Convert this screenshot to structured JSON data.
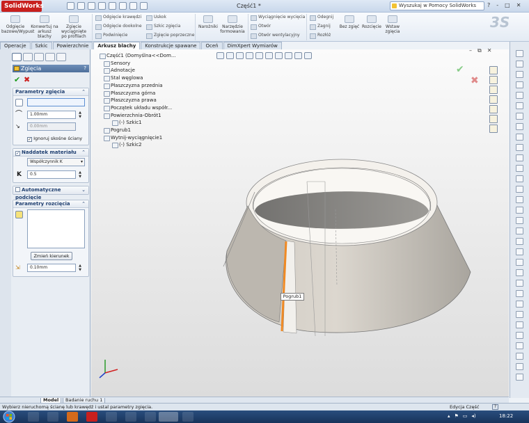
{
  "app": {
    "name": "SolidWorks",
    "doc_title": "Część1 *",
    "help_search": "Wyszukaj w Pomocy SolidWorks",
    "title_controls": [
      "?",
      "-",
      "□",
      "✕"
    ]
  },
  "ribbon": {
    "big_buttons": [
      {
        "label": "Odgięcie bazowe/Wypust"
      },
      {
        "label": "Konwertuj na arkusz blachy"
      },
      {
        "label": "Zgięcie wyciągnięte po profilach"
      }
    ],
    "col2": [
      "Odgięcie krawędzi",
      "Odgięcie dookolne",
      "Podwinięcie"
    ],
    "col3": [
      "Uskok",
      "Szkic zgięcia",
      "Zgięcie poprzeczne"
    ],
    "narozniki": "Narożniki",
    "narzedzie": "Narzędzie formowania",
    "col6": [
      "Wyciągnięcie wycięcia",
      "Otwór",
      "Otwór wentylacyjny"
    ],
    "col7": [
      "Odegnij",
      "Zagnij",
      "Rozłóż"
    ],
    "bez_zgiec": "Bez zgięć",
    "rozciecie": "Rozcięcie",
    "wstaw_zgiecia": "Wstaw zgięcia"
  },
  "tabs": [
    "Operacje",
    "Szkic",
    "Powierzchnie",
    "Arkusz blachy",
    "Konstrukcje spawane",
    "Oceń",
    "DimXpert Wymiarów"
  ],
  "active_tab": "Arkusz blachy",
  "property_manager": {
    "title": "Zgięcia",
    "help": "?",
    "ok": "✔",
    "cancel": "✖",
    "bend_params": {
      "header": "Parametry zgięcia",
      "radius": "1.00mm",
      "thickness": "0.00mm",
      "ignore_label": "Ignoruj skośne ściany",
      "ignore_checked": true
    },
    "allowance": {
      "header": "Naddatek materiału",
      "type": "Współczynnik K",
      "k_label": "K",
      "k_value": "0.5"
    },
    "auto_relief": {
      "header": "Automatyczne podcięcie"
    },
    "rip": {
      "header": "Parametry rozcięcia",
      "button": "Zmień kierunek",
      "gap": "0.10mm"
    }
  },
  "feature_tree": [
    {
      "label": "Część1  (Domyślna<<Dom..."
    },
    {
      "label": "Sensory"
    },
    {
      "label": "Adnotacje"
    },
    {
      "label": "Stal węglowa"
    },
    {
      "label": "Płaszczyzna przednia"
    },
    {
      "label": "Płaszczyzna górna"
    },
    {
      "label": "Płaszczyzna prawa"
    },
    {
      "label": "Początek układu współr..."
    },
    {
      "label": "Powierzchnia-Obrót1"
    },
    {
      "label": "(-) Szkic1"
    },
    {
      "label": "Pogrub1"
    },
    {
      "label": "Wytnij-wyciągnięcie1"
    },
    {
      "label": "(-) Szkic2"
    }
  ],
  "callout": "Pogrub1",
  "bottom_tabs": [
    "Model",
    "Badanie ruchu 1"
  ],
  "status": {
    "message": "Wybierz nieruchomą ścianę lub krawędź i ustal parametry zgięcia.",
    "mode": "Edycja Część",
    "help": "?"
  },
  "clock": "18:22",
  "colors": {
    "accent_orange": "#f08a24",
    "solidworks_red": "#c8201e",
    "header_blue": "#4d6f9b"
  }
}
